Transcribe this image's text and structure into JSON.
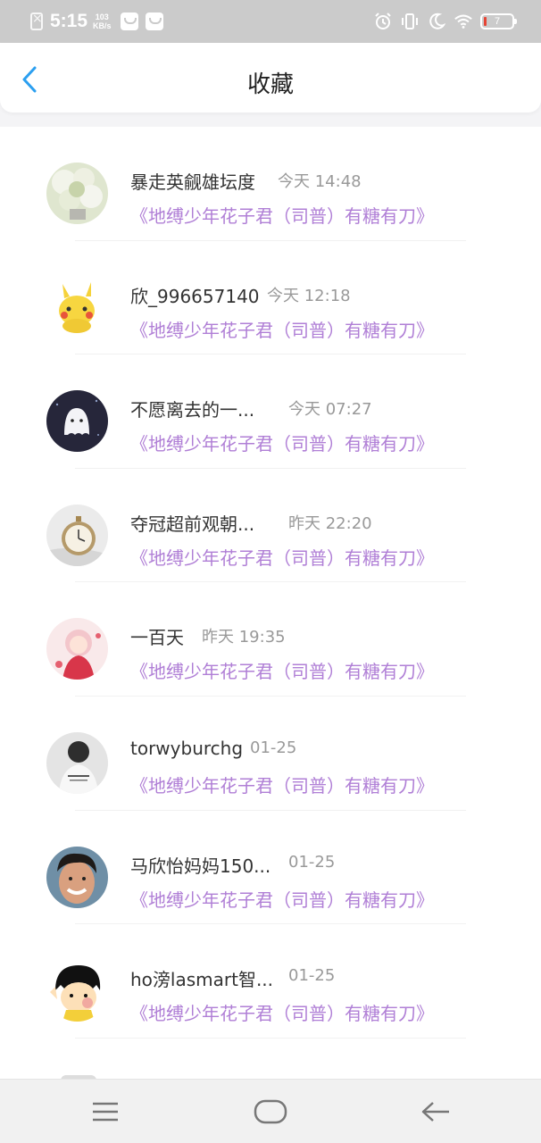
{
  "status_bar": {
    "time": "5:15",
    "speed_value": "103",
    "speed_unit": "KB/s",
    "battery": "7",
    "icons": [
      "notification-x-icon",
      "message-icon",
      "message-icon",
      "alarm-icon",
      "vibrate-icon",
      "moon-icon",
      "wifi-icon",
      "battery-icon"
    ]
  },
  "header": {
    "title": "收藏",
    "back_icon": "chevron-left-icon"
  },
  "favorites": [
    {
      "name": "暴走英觎雄坛度",
      "time": "今天 14:48",
      "topic": "《地缚少年花子君（司普）有糖有刀》",
      "avatar": "flowers"
    },
    {
      "name": "欣_996657140",
      "time": "今天 12:18",
      "topic": "《地缚少年花子君（司普）有糖有刀》",
      "avatar": "pikachu"
    },
    {
      "name": "不愿离去的一...",
      "time": "今天 07:27",
      "topic": "《地缚少年花子君（司普）有糖有刀》",
      "avatar": "ghost"
    },
    {
      "name": "夺冠超前观朝...",
      "time": "昨天 22:20",
      "topic": "《地缚少年花子君（司普）有糖有刀》",
      "avatar": "pocket-watch"
    },
    {
      "name": "一百天",
      "time": "昨天 19:35",
      "topic": "《地缚少年花子君（司普）有糖有刀》",
      "avatar": "anime-girl"
    },
    {
      "name": "torwyburchg",
      "time": "01-25",
      "topic": "《地缚少年花子君（司普）有糖有刀》",
      "avatar": "girl-back"
    },
    {
      "name": "马欣怡妈妈150...",
      "time": "01-25",
      "topic": "《地缚少年花子君（司普）有糖有刀》",
      "avatar": "smiling-man"
    },
    {
      "name": "ho滂lasmart智...",
      "time": "01-25",
      "topic": "《地缚少年花子君（司普）有糖有刀》",
      "avatar": "cartoon-kid"
    }
  ],
  "nav_bar": {
    "buttons": [
      "menu-icon",
      "home-icon",
      "back-arrow-icon"
    ]
  },
  "colors": {
    "accent": "#2b9ff0",
    "topic_purple": "#b07fd6",
    "status_bar": "#cbcbcb"
  }
}
